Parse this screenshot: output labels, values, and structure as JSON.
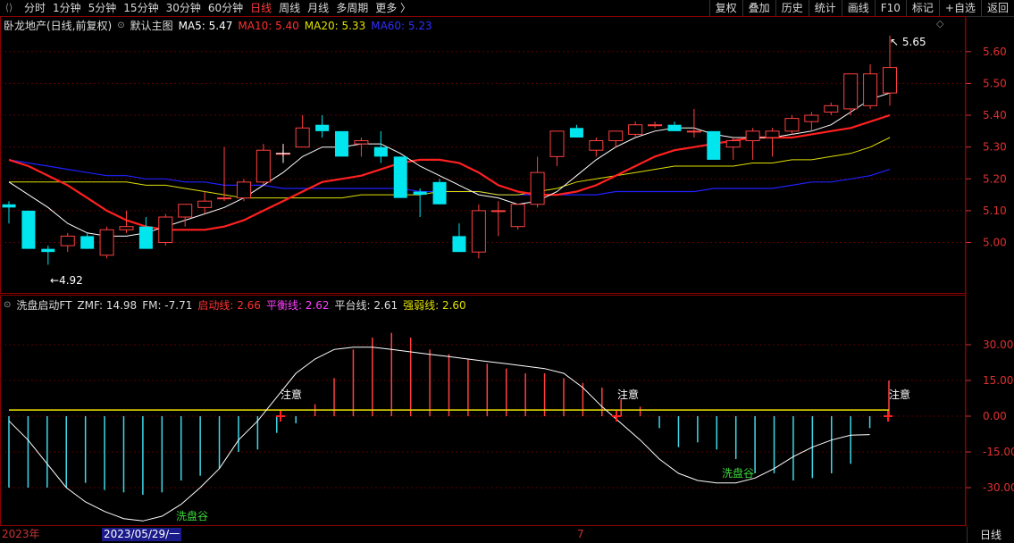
{
  "toolbar": {
    "periods": [
      "分时",
      "1分钟",
      "5分钟",
      "15分钟",
      "30分钟",
      "60分钟",
      "日线",
      "周线",
      "月线",
      "多周期",
      "更多 〉"
    ],
    "active_period": "日线",
    "right_buttons": [
      "复权",
      "叠加",
      "历史",
      "统计",
      "画线",
      "F10",
      "标记",
      "+自选",
      "返回"
    ]
  },
  "main_panel": {
    "stock_name": "卧龙地产(日线,前复权)",
    "chart_label": "默认主图",
    "ma5": "MA5: 5.47",
    "ma10": "MA10: 5.40",
    "ma20": "MA20: 5.33",
    "ma60": "MA60: 5.23",
    "high_label": "5.65",
    "low_label": "4.92",
    "colors": {
      "ma5": "#ffffff",
      "ma10": "#ff2020",
      "ma20": "#e0e000",
      "ma60": "#2020ff",
      "up": "#ff4040",
      "down": "#00e5ee"
    }
  },
  "sub_panel": {
    "indicator": "洗盘启动FT",
    "zmf": "ZMF: 14.98",
    "fm": "FM: -7.71",
    "start_line": "启动线: 2.66",
    "balance_line": "平衡线: 2.62",
    "platform_line": "平台线: 2.61",
    "strength_line": "强弱线: 2.60",
    "annotation_notice": "注意",
    "annotation_valley": "洗盘谷"
  },
  "chart_data": [
    {
      "type": "candlestick",
      "ylim": [
        4.9,
        5.7
      ],
      "yticks": [
        "5.60",
        "5.50",
        "5.40",
        "5.30",
        "5.20",
        "5.10",
        "5.00"
      ],
      "ohlc": [
        [
          5.12,
          5.13,
          5.06,
          5.11
        ],
        [
          5.1,
          5.1,
          4.98,
          4.98
        ],
        [
          4.98,
          4.99,
          4.93,
          4.97
        ],
        [
          4.99,
          5.03,
          4.97,
          5.02
        ],
        [
          5.02,
          5.03,
          4.98,
          4.98
        ],
        [
          4.96,
          5.05,
          4.95,
          5.04
        ],
        [
          5.04,
          5.1,
          5.03,
          5.05
        ],
        [
          5.05,
          5.08,
          4.98,
          4.98
        ],
        [
          5.0,
          5.09,
          4.99,
          5.08
        ],
        [
          5.08,
          5.12,
          5.05,
          5.12
        ],
        [
          5.11,
          5.16,
          5.09,
          5.13
        ],
        [
          5.14,
          5.3,
          5.13,
          5.14
        ],
        [
          5.14,
          5.2,
          5.13,
          5.19
        ],
        [
          5.19,
          5.31,
          5.18,
          5.29
        ],
        [
          5.28,
          5.29,
          5.27,
          5.28
        ],
        [
          5.3,
          5.4,
          5.3,
          5.36
        ],
        [
          5.37,
          5.4,
          5.33,
          5.35
        ],
        [
          5.35,
          5.35,
          5.27,
          5.27
        ],
        [
          5.31,
          5.33,
          5.27,
          5.32
        ],
        [
          5.3,
          5.35,
          5.25,
          5.27
        ],
        [
          5.27,
          5.27,
          5.14,
          5.14
        ],
        [
          5.16,
          5.17,
          5.08,
          5.15
        ],
        [
          5.19,
          5.2,
          5.12,
          5.12
        ],
        [
          5.02,
          5.06,
          4.97,
          4.97
        ],
        [
          4.97,
          5.12,
          4.95,
          5.1
        ],
        [
          5.1,
          5.13,
          5.02,
          5.1
        ],
        [
          5.05,
          5.12,
          5.04,
          5.12
        ],
        [
          5.12,
          5.27,
          5.11,
          5.22
        ],
        [
          5.27,
          5.35,
          5.24,
          5.35
        ],
        [
          5.36,
          5.37,
          5.33,
          5.33
        ],
        [
          5.29,
          5.33,
          5.27,
          5.32
        ],
        [
          5.32,
          5.35,
          5.3,
          5.35
        ],
        [
          5.34,
          5.38,
          5.33,
          5.37
        ],
        [
          5.37,
          5.38,
          5.36,
          5.37
        ],
        [
          5.37,
          5.38,
          5.35,
          5.35
        ],
        [
          5.35,
          5.42,
          5.33,
          5.35
        ],
        [
          5.35,
          5.35,
          5.26,
          5.26
        ],
        [
          5.3,
          5.33,
          5.26,
          5.32
        ],
        [
          5.32,
          5.36,
          5.26,
          5.35
        ],
        [
          5.33,
          5.36,
          5.27,
          5.35
        ],
        [
          5.35,
          5.4,
          5.34,
          5.39
        ],
        [
          5.38,
          5.41,
          5.35,
          5.4
        ],
        [
          5.41,
          5.44,
          5.4,
          5.43
        ],
        [
          5.42,
          5.48,
          5.4,
          5.53
        ],
        [
          5.43,
          5.56,
          5.42,
          5.53
        ],
        [
          5.47,
          5.65,
          5.43,
          5.55
        ]
      ],
      "ma5": [
        5.19,
        5.15,
        5.11,
        5.06,
        5.03,
        5.02,
        5.02,
        5.03,
        5.05,
        5.07,
        5.09,
        5.11,
        5.14,
        5.18,
        5.22,
        5.27,
        5.3,
        5.3,
        5.31,
        5.31,
        5.28,
        5.24,
        5.21,
        5.18,
        5.15,
        5.14,
        5.12,
        5.13,
        5.16,
        5.21,
        5.26,
        5.3,
        5.33,
        5.35,
        5.36,
        5.36,
        5.34,
        5.33,
        5.33,
        5.33,
        5.34,
        5.35,
        5.37,
        5.41,
        5.45,
        5.47
      ],
      "ma10": [
        5.26,
        5.24,
        5.21,
        5.18,
        5.14,
        5.1,
        5.07,
        5.05,
        5.04,
        5.04,
        5.04,
        5.05,
        5.07,
        5.1,
        5.13,
        5.16,
        5.19,
        5.2,
        5.21,
        5.23,
        5.25,
        5.26,
        5.26,
        5.25,
        5.22,
        5.18,
        5.16,
        5.15,
        5.15,
        5.16,
        5.18,
        5.21,
        5.24,
        5.27,
        5.29,
        5.3,
        5.31,
        5.32,
        5.33,
        5.33,
        5.33,
        5.34,
        5.35,
        5.36,
        5.38,
        5.4
      ],
      "ma20": [
        5.19,
        5.19,
        5.19,
        5.19,
        5.19,
        5.19,
        5.19,
        5.18,
        5.18,
        5.17,
        5.16,
        5.15,
        5.14,
        5.14,
        5.14,
        5.14,
        5.14,
        5.14,
        5.15,
        5.15,
        5.15,
        5.15,
        5.16,
        5.16,
        5.16,
        5.15,
        5.15,
        5.16,
        5.17,
        5.19,
        5.2,
        5.21,
        5.22,
        5.23,
        5.24,
        5.24,
        5.24,
        5.24,
        5.25,
        5.25,
        5.26,
        5.26,
        5.27,
        5.28,
        5.3,
        5.33
      ],
      "ma60": [
        5.26,
        5.25,
        5.24,
        5.23,
        5.22,
        5.21,
        5.21,
        5.2,
        5.2,
        5.19,
        5.19,
        5.18,
        5.18,
        5.18,
        5.17,
        5.17,
        5.17,
        5.17,
        5.17,
        5.17,
        5.17,
        5.16,
        5.16,
        5.16,
        5.16,
        5.15,
        5.15,
        5.15,
        5.15,
        5.15,
        5.15,
        5.16,
        5.16,
        5.16,
        5.16,
        5.16,
        5.17,
        5.17,
        5.17,
        5.17,
        5.18,
        5.19,
        5.19,
        5.2,
        5.21,
        5.23
      ]
    },
    {
      "type": "bar",
      "ylim": [
        -45,
        45
      ],
      "yticks": [
        "30.00",
        "15.00",
        "0.00",
        "-15.00",
        "-30.00"
      ],
      "bars": [
        -30,
        -30,
        -30,
        -30,
        -28,
        -31,
        -32,
        -33,
        -32,
        -27,
        -25,
        -22,
        -15,
        -14,
        -7,
        -3,
        5,
        16,
        28,
        33,
        35,
        33,
        28,
        26,
        24,
        22,
        20,
        18,
        18,
        16,
        14,
        12,
        7,
        4,
        -5,
        -13,
        -11,
        -14,
        -18,
        -24,
        -24,
        -27,
        -26,
        -24,
        -20,
        -5,
        14.98
      ],
      "zmf_line": [
        -2,
        -10,
        -20,
        -30,
        -36,
        -40,
        -43,
        -44,
        -42,
        -37,
        -30,
        -22,
        -10,
        -2,
        8,
        18,
        24,
        28,
        29,
        29,
        28,
        27,
        26,
        25,
        24,
        23,
        22,
        21,
        20,
        18,
        12,
        4,
        -3,
        -10,
        -18,
        -24,
        -27,
        -28,
        -28,
        -26,
        -22,
        -17,
        -13,
        -10,
        -8,
        -7.71
      ]
    }
  ]
}
